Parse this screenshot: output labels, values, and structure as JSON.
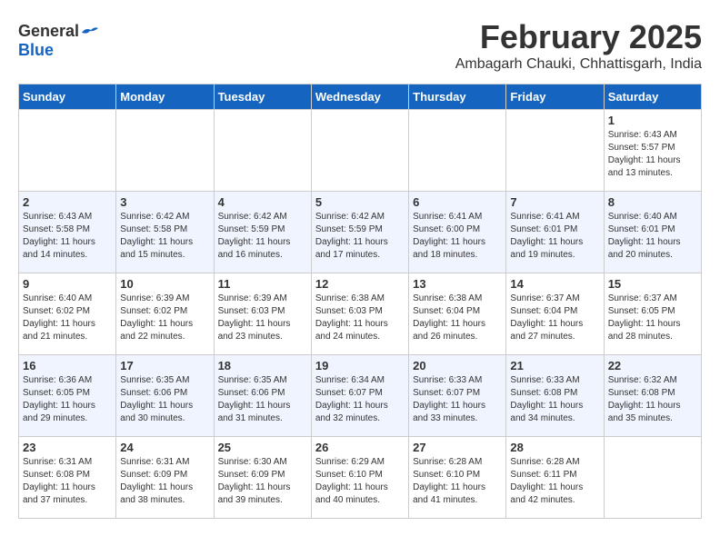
{
  "header": {
    "logo_general": "General",
    "logo_blue": "Blue",
    "month_year": "February 2025",
    "location": "Ambagarh Chauki, Chhattisgarh, India"
  },
  "weekdays": [
    "Sunday",
    "Monday",
    "Tuesday",
    "Wednesday",
    "Thursday",
    "Friday",
    "Saturday"
  ],
  "weeks": [
    [
      {
        "day": "",
        "info": ""
      },
      {
        "day": "",
        "info": ""
      },
      {
        "day": "",
        "info": ""
      },
      {
        "day": "",
        "info": ""
      },
      {
        "day": "",
        "info": ""
      },
      {
        "day": "",
        "info": ""
      },
      {
        "day": "1",
        "info": "Sunrise: 6:43 AM\nSunset: 5:57 PM\nDaylight: 11 hours\nand 13 minutes."
      }
    ],
    [
      {
        "day": "2",
        "info": "Sunrise: 6:43 AM\nSunset: 5:58 PM\nDaylight: 11 hours\nand 14 minutes."
      },
      {
        "day": "3",
        "info": "Sunrise: 6:42 AM\nSunset: 5:58 PM\nDaylight: 11 hours\nand 15 minutes."
      },
      {
        "day": "4",
        "info": "Sunrise: 6:42 AM\nSunset: 5:59 PM\nDaylight: 11 hours\nand 16 minutes."
      },
      {
        "day": "5",
        "info": "Sunrise: 6:42 AM\nSunset: 5:59 PM\nDaylight: 11 hours\nand 17 minutes."
      },
      {
        "day": "6",
        "info": "Sunrise: 6:41 AM\nSunset: 6:00 PM\nDaylight: 11 hours\nand 18 minutes."
      },
      {
        "day": "7",
        "info": "Sunrise: 6:41 AM\nSunset: 6:01 PM\nDaylight: 11 hours\nand 19 minutes."
      },
      {
        "day": "8",
        "info": "Sunrise: 6:40 AM\nSunset: 6:01 PM\nDaylight: 11 hours\nand 20 minutes."
      }
    ],
    [
      {
        "day": "9",
        "info": "Sunrise: 6:40 AM\nSunset: 6:02 PM\nDaylight: 11 hours\nand 21 minutes."
      },
      {
        "day": "10",
        "info": "Sunrise: 6:39 AM\nSunset: 6:02 PM\nDaylight: 11 hours\nand 22 minutes."
      },
      {
        "day": "11",
        "info": "Sunrise: 6:39 AM\nSunset: 6:03 PM\nDaylight: 11 hours\nand 23 minutes."
      },
      {
        "day": "12",
        "info": "Sunrise: 6:38 AM\nSunset: 6:03 PM\nDaylight: 11 hours\nand 24 minutes."
      },
      {
        "day": "13",
        "info": "Sunrise: 6:38 AM\nSunset: 6:04 PM\nDaylight: 11 hours\nand 26 minutes."
      },
      {
        "day": "14",
        "info": "Sunrise: 6:37 AM\nSunset: 6:04 PM\nDaylight: 11 hours\nand 27 minutes."
      },
      {
        "day": "15",
        "info": "Sunrise: 6:37 AM\nSunset: 6:05 PM\nDaylight: 11 hours\nand 28 minutes."
      }
    ],
    [
      {
        "day": "16",
        "info": "Sunrise: 6:36 AM\nSunset: 6:05 PM\nDaylight: 11 hours\nand 29 minutes."
      },
      {
        "day": "17",
        "info": "Sunrise: 6:35 AM\nSunset: 6:06 PM\nDaylight: 11 hours\nand 30 minutes."
      },
      {
        "day": "18",
        "info": "Sunrise: 6:35 AM\nSunset: 6:06 PM\nDaylight: 11 hours\nand 31 minutes."
      },
      {
        "day": "19",
        "info": "Sunrise: 6:34 AM\nSunset: 6:07 PM\nDaylight: 11 hours\nand 32 minutes."
      },
      {
        "day": "20",
        "info": "Sunrise: 6:33 AM\nSunset: 6:07 PM\nDaylight: 11 hours\nand 33 minutes."
      },
      {
        "day": "21",
        "info": "Sunrise: 6:33 AM\nSunset: 6:08 PM\nDaylight: 11 hours\nand 34 minutes."
      },
      {
        "day": "22",
        "info": "Sunrise: 6:32 AM\nSunset: 6:08 PM\nDaylight: 11 hours\nand 35 minutes."
      }
    ],
    [
      {
        "day": "23",
        "info": "Sunrise: 6:31 AM\nSunset: 6:08 PM\nDaylight: 11 hours\nand 37 minutes."
      },
      {
        "day": "24",
        "info": "Sunrise: 6:31 AM\nSunset: 6:09 PM\nDaylight: 11 hours\nand 38 minutes."
      },
      {
        "day": "25",
        "info": "Sunrise: 6:30 AM\nSunset: 6:09 PM\nDaylight: 11 hours\nand 39 minutes."
      },
      {
        "day": "26",
        "info": "Sunrise: 6:29 AM\nSunset: 6:10 PM\nDaylight: 11 hours\nand 40 minutes."
      },
      {
        "day": "27",
        "info": "Sunrise: 6:28 AM\nSunset: 6:10 PM\nDaylight: 11 hours\nand 41 minutes."
      },
      {
        "day": "28",
        "info": "Sunrise: 6:28 AM\nSunset: 6:11 PM\nDaylight: 11 hours\nand 42 minutes."
      },
      {
        "day": "",
        "info": ""
      }
    ]
  ]
}
